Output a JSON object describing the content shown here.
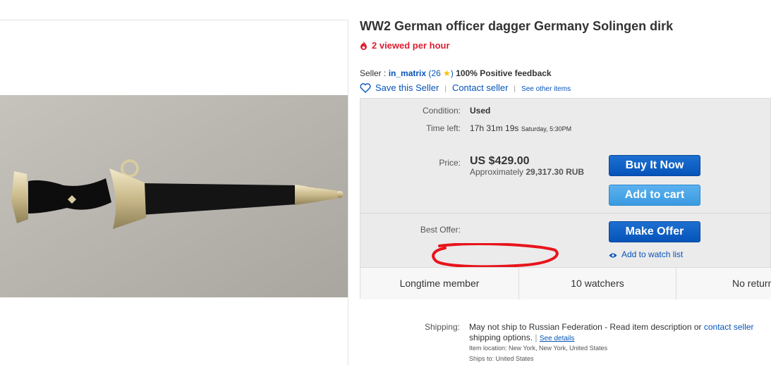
{
  "listing": {
    "title": "WW2 German officer dagger Germany Solingen dirk",
    "views": "2 viewed per hour"
  },
  "seller": {
    "label": "Seller :",
    "name": "in_matrix",
    "score_open": "(26",
    "score_close": ")",
    "feedback": "100% Positive feedback",
    "save_label": "Save this Seller",
    "contact_label": "Contact seller",
    "see_items_label": "See other items"
  },
  "details": {
    "condition_label": "Condition:",
    "condition_value": "Used",
    "time_label": "Time left:",
    "time_value": "17h 31m 19s",
    "time_when": "Saturday, 5:30PM",
    "price_label": "Price:",
    "price": "US $429.00",
    "approx_label": "Approximately",
    "approx_value": "29,317.30 RUB",
    "best_offer_label": "Best Offer:"
  },
  "buttons": {
    "buy_now": "Buy It Now",
    "add_to_cart": "Add to cart",
    "make_offer": "Make Offer",
    "watch": "Add to watch list"
  },
  "stats": [
    "Longtime member",
    "10 watchers",
    "No returns"
  ],
  "shipping": {
    "label": "Shipping:",
    "text": "May not ship to Russian Federation - Read item description or",
    "contact": "contact seller",
    "text2": "shipping options.",
    "see_details": "See details",
    "location": "Item location:  New York, New York, United States",
    "ships_to": "Ships to:  United States"
  },
  "colors": {
    "link": "#0654ba",
    "views_red": "#dd1e31",
    "annotation_red": "#e8141c"
  }
}
